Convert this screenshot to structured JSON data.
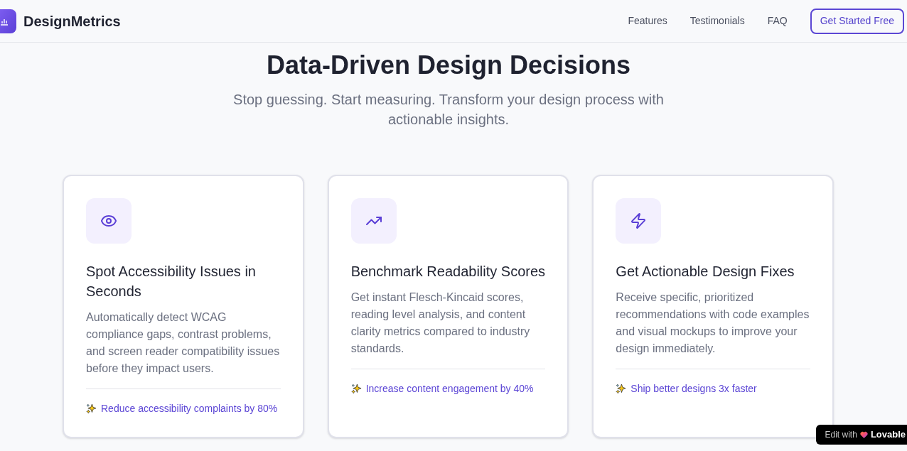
{
  "header": {
    "brand": "DesignMetrics",
    "nav": [
      {
        "label": "Features"
      },
      {
        "label": "Testimonials"
      },
      {
        "label": "FAQ"
      }
    ],
    "cta": "Get Started Free"
  },
  "hero": {
    "title": "Data-Driven Design Decisions",
    "subtitle": "Stop guessing. Start measuring. Transform your design process with actionable insights."
  },
  "features": [
    {
      "title": "Spot Accessibility Issues in Seconds",
      "description": "Automatically detect WCAG compliance gaps, contrast problems, and screen reader compatibility issues before they impact users.",
      "benefit": "Reduce accessibility complaints by 80%"
    },
    {
      "title": "Benchmark Readability Scores",
      "description": "Get instant Flesch-Kincaid scores, reading level analysis, and content clarity metrics compared to industry standards.",
      "benefit": "Increase content engagement by 40%"
    },
    {
      "title": "Get Actionable Design Fixes",
      "description": "Receive specific, prioritized recommendations with code examples and visual mockups to improve your design immediately.",
      "benefit": "Ship better designs 3x faster"
    }
  ],
  "badge": {
    "prefix": "Edit with",
    "brand": "Lovable"
  }
}
